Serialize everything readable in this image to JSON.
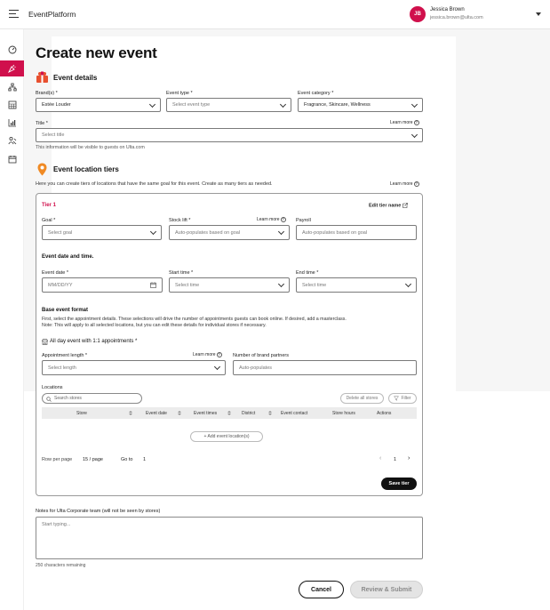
{
  "header": {
    "app_title": "EventPlatform",
    "user_initials": "JB",
    "user_name": "Jessica Brown",
    "user_email": "jessica.brown@ulta.com"
  },
  "nav": {
    "items": [
      "dashboard-icon",
      "events-icon",
      "hierarchy-icon",
      "calendar-grid-icon",
      "analytics-icon",
      "people-icon",
      "calendar-icon"
    ],
    "active_index": 1,
    "accent_color": "#d0104c"
  },
  "page": {
    "title": "Create new event"
  },
  "event_details": {
    "title": "Event details",
    "brand_label": "Brand(s) *",
    "brand_value": "Estée Louder",
    "event_type_label": "Event type *",
    "event_type_placeholder": "Select event type",
    "event_category_label": "Event category *",
    "event_category_value": "Fragrance, Skincare, Wellness",
    "title_label": "Title *",
    "title_learn_more": "Learn more",
    "title_placeholder": "Select title",
    "title_help": "This information will be visible to guests on Ulta.com"
  },
  "location_tiers": {
    "title": "Event location tiers",
    "description": "Here you can create tiers of locations that have the same goal for this event. Create as many tiers as needed.",
    "learn_more": "Learn more"
  },
  "tier": {
    "title": "Tier 1",
    "edit_name": "Edit tier name",
    "goal_label": "Goal *",
    "goal_placeholder": "Select goal",
    "stock_lift_label": "Stock lift *",
    "stock_lift_learn_more": "Learn more",
    "stock_lift_placeholder": "Auto-populates based on goal",
    "payroll_label": "Payroll",
    "payroll_placeholder": "Auto-populates based on goal",
    "date_time_title": "Event date and time.",
    "event_date_label": "Event date *",
    "event_date_placeholder": "MM/DD/YY",
    "start_time_label": "Start time *",
    "start_time_placeholder": "Select time",
    "end_time_label": "End time *",
    "end_time_placeholder": "Select time",
    "base_format_title": "Base event format",
    "base_format_line1": "First, select the appointment details. These selections will drive the number of appointments guests can book online. If desired, add a masterclass.",
    "base_format_line2": "Note: This will apply to all selected locations, but you can edit these details for individual stores if necessary.",
    "all_day_label": "All day event with 1:1 appointments *",
    "appt_length_label": "Appointment length *",
    "appt_learn_more": "Learn more",
    "appt_length_placeholder": "Select length",
    "brand_partners_label": "Number of brand partners",
    "brand_partners_placeholder": "Auto-populates",
    "locations_label": "Locations",
    "search_placeholder": "Search stores",
    "delete_all_label": "Delete all stores",
    "filter_label": "Filter",
    "columns": [
      "Store",
      "Event date",
      "Event times",
      "District",
      "Event contact",
      "Store hours",
      "Actions"
    ],
    "add_location_label": "+ Add event location(s)",
    "rows_per_page_label": "Row per page",
    "rows_per_page_value": "15 / page",
    "go_to_label": "Go to",
    "go_to_value": "1",
    "current_page": "1",
    "save_tier_label": "Save tier"
  },
  "notes": {
    "label": "Notes for Ulta Corporate team (will not be seen by stores)",
    "placeholder": "Start typing...",
    "remaining": "250 characters remaining"
  },
  "footer": {
    "cancel_label": "Cancel",
    "submit_label": "Review & Submit"
  }
}
